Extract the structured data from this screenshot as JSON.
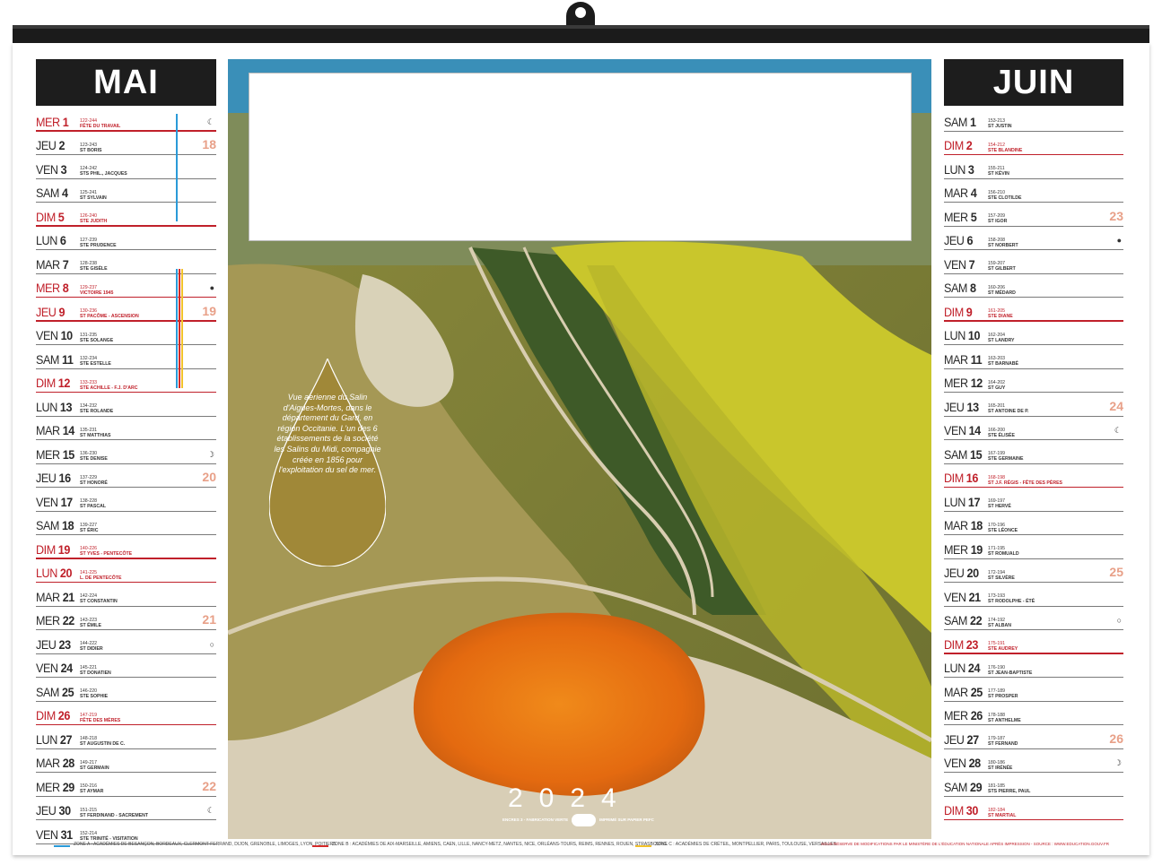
{
  "may": {
    "title": "MAI",
    "days": [
      {
        "wd": "MER",
        "n": "1",
        "num": "122-244",
        "saint": "FÊTE DU TRAVAIL",
        "red": true,
        "week": "",
        "moon": "☾"
      },
      {
        "wd": "JEU",
        "n": "2",
        "num": "123-243",
        "saint": "ST BORIS",
        "red": false,
        "week": "18",
        "moon": ""
      },
      {
        "wd": "VEN",
        "n": "3",
        "num": "124-242",
        "saint": "STS PHIL., JACQUES",
        "red": false,
        "week": "",
        "moon": ""
      },
      {
        "wd": "SAM",
        "n": "4",
        "num": "125-241",
        "saint": "ST SYLVAIN",
        "red": false,
        "week": "",
        "moon": ""
      },
      {
        "wd": "DIM",
        "n": "5",
        "num": "126-240",
        "saint": "STE JUDITH",
        "red": true,
        "week": "",
        "moon": ""
      },
      {
        "wd": "LUN",
        "n": "6",
        "num": "127-239",
        "saint": "STE PRUDENCE",
        "red": false,
        "week": "",
        "moon": ""
      },
      {
        "wd": "MAR",
        "n": "7",
        "num": "128-238",
        "saint": "STE GISÈLE",
        "red": false,
        "week": "",
        "moon": ""
      },
      {
        "wd": "MER",
        "n": "8",
        "num": "129-237",
        "saint": "VICTOIRE 1945",
        "red": true,
        "week": "",
        "moon": "●"
      },
      {
        "wd": "JEU",
        "n": "9",
        "num": "130-236",
        "saint": "ST PACÔME - ASCENSION",
        "red": true,
        "week": "19",
        "moon": ""
      },
      {
        "wd": "VEN",
        "n": "10",
        "num": "131-235",
        "saint": "STE SOLANGE",
        "red": false,
        "week": "",
        "moon": ""
      },
      {
        "wd": "SAM",
        "n": "11",
        "num": "132-234",
        "saint": "STE ESTELLE",
        "red": false,
        "week": "",
        "moon": ""
      },
      {
        "wd": "DIM",
        "n": "12",
        "num": "133-233",
        "saint": "STE ACHILLE - F.J. D'ARC",
        "red": true,
        "week": "",
        "moon": ""
      },
      {
        "wd": "LUN",
        "n": "13",
        "num": "134-232",
        "saint": "STE ROLANDE",
        "red": false,
        "week": "",
        "moon": ""
      },
      {
        "wd": "MAR",
        "n": "14",
        "num": "135-231",
        "saint": "ST MATTHIAS",
        "red": false,
        "week": "",
        "moon": ""
      },
      {
        "wd": "MER",
        "n": "15",
        "num": "136-230",
        "saint": "STE DENISE",
        "red": false,
        "week": "",
        "moon": "☽"
      },
      {
        "wd": "JEU",
        "n": "16",
        "num": "137-229",
        "saint": "ST HONORÉ",
        "red": false,
        "week": "20",
        "moon": ""
      },
      {
        "wd": "VEN",
        "n": "17",
        "num": "138-228",
        "saint": "ST PASCAL",
        "red": false,
        "week": "",
        "moon": ""
      },
      {
        "wd": "SAM",
        "n": "18",
        "num": "139-227",
        "saint": "ST ÉRIC",
        "red": false,
        "week": "",
        "moon": ""
      },
      {
        "wd": "DIM",
        "n": "19",
        "num": "140-226",
        "saint": "ST YVES - PENTECÔTE",
        "red": true,
        "week": "",
        "moon": ""
      },
      {
        "wd": "LUN",
        "n": "20",
        "num": "141-225",
        "saint": "L. DE PENTECÔTE",
        "red": true,
        "week": "",
        "moon": ""
      },
      {
        "wd": "MAR",
        "n": "21",
        "num": "142-224",
        "saint": "ST CONSTANTIN",
        "red": false,
        "week": "",
        "moon": ""
      },
      {
        "wd": "MER",
        "n": "22",
        "num": "143-223",
        "saint": "ST ÉMILE",
        "red": false,
        "week": "21",
        "moon": ""
      },
      {
        "wd": "JEU",
        "n": "23",
        "num": "144-222",
        "saint": "ST DIDIER",
        "red": false,
        "week": "",
        "moon": "○"
      },
      {
        "wd": "VEN",
        "n": "24",
        "num": "145-221",
        "saint": "ST DONATIEN",
        "red": false,
        "week": "",
        "moon": ""
      },
      {
        "wd": "SAM",
        "n": "25",
        "num": "146-220",
        "saint": "STE SOPHIE",
        "red": false,
        "week": "",
        "moon": ""
      },
      {
        "wd": "DIM",
        "n": "26",
        "num": "147-219",
        "saint": "FÊTE DES MÈRES",
        "red": true,
        "week": "",
        "moon": ""
      },
      {
        "wd": "LUN",
        "n": "27",
        "num": "148-218",
        "saint": "ST AUGUSTIN DE C.",
        "red": false,
        "week": "",
        "moon": ""
      },
      {
        "wd": "MAR",
        "n": "28",
        "num": "149-217",
        "saint": "ST GERMAIN",
        "red": false,
        "week": "",
        "moon": ""
      },
      {
        "wd": "MER",
        "n": "29",
        "num": "150-216",
        "saint": "ST AYMAR",
        "red": false,
        "week": "22",
        "moon": ""
      },
      {
        "wd": "JEU",
        "n": "30",
        "num": "151-215",
        "saint": "ST FERDINAND - SACREMENT",
        "red": false,
        "week": "",
        "moon": "☾"
      },
      {
        "wd": "VEN",
        "n": "31",
        "num": "152-214",
        "saint": "STE TRINITÉ - VISITATION",
        "red": false,
        "week": "",
        "moon": ""
      }
    ]
  },
  "june": {
    "title": "JUIN",
    "days": [
      {
        "wd": "SAM",
        "n": "1",
        "num": "153-213",
        "saint": "ST JUSTIN",
        "red": false,
        "week": "",
        "moon": ""
      },
      {
        "wd": "DIM",
        "n": "2",
        "num": "154-212",
        "saint": "STE BLANDINE",
        "red": true,
        "week": "",
        "moon": ""
      },
      {
        "wd": "LUN",
        "n": "3",
        "num": "155-211",
        "saint": "ST KÉVIN",
        "red": false,
        "week": "",
        "moon": ""
      },
      {
        "wd": "MAR",
        "n": "4",
        "num": "156-210",
        "saint": "STE CLOTILDE",
        "red": false,
        "week": "",
        "moon": ""
      },
      {
        "wd": "MER",
        "n": "5",
        "num": "157-209",
        "saint": "ST IGOR",
        "red": false,
        "week": "23",
        "moon": ""
      },
      {
        "wd": "JEU",
        "n": "6",
        "num": "158-208",
        "saint": "ST NORBERT",
        "red": false,
        "week": "",
        "moon": "●"
      },
      {
        "wd": "VEN",
        "n": "7",
        "num": "159-207",
        "saint": "ST GILBERT",
        "red": false,
        "week": "",
        "moon": ""
      },
      {
        "wd": "SAM",
        "n": "8",
        "num": "160-206",
        "saint": "ST MÉDARD",
        "red": false,
        "week": "",
        "moon": ""
      },
      {
        "wd": "DIM",
        "n": "9",
        "num": "161-205",
        "saint": "STE DIANE",
        "red": true,
        "week": "",
        "moon": ""
      },
      {
        "wd": "LUN",
        "n": "10",
        "num": "162-204",
        "saint": "ST LANDRY",
        "red": false,
        "week": "",
        "moon": ""
      },
      {
        "wd": "MAR",
        "n": "11",
        "num": "163-203",
        "saint": "ST BARNABÉ",
        "red": false,
        "week": "",
        "moon": ""
      },
      {
        "wd": "MER",
        "n": "12",
        "num": "164-202",
        "saint": "ST GUY",
        "red": false,
        "week": "",
        "moon": ""
      },
      {
        "wd": "JEU",
        "n": "13",
        "num": "165-201",
        "saint": "ST ANTOINE DE P.",
        "red": false,
        "week": "24",
        "moon": ""
      },
      {
        "wd": "VEN",
        "n": "14",
        "num": "166-200",
        "saint": "STE ÉLISÉE",
        "red": false,
        "week": "",
        "moon": "☾"
      },
      {
        "wd": "SAM",
        "n": "15",
        "num": "167-199",
        "saint": "STE GERMAINE",
        "red": false,
        "week": "",
        "moon": ""
      },
      {
        "wd": "DIM",
        "n": "16",
        "num": "168-198",
        "saint": "ST J.F. RÉGIS - FÊTE DES PÈRES",
        "red": true,
        "week": "",
        "moon": ""
      },
      {
        "wd": "LUN",
        "n": "17",
        "num": "169-197",
        "saint": "ST HERVÉ",
        "red": false,
        "week": "",
        "moon": ""
      },
      {
        "wd": "MAR",
        "n": "18",
        "num": "170-196",
        "saint": "STE LÉONCE",
        "red": false,
        "week": "",
        "moon": ""
      },
      {
        "wd": "MER",
        "n": "19",
        "num": "171-195",
        "saint": "ST ROMUALD",
        "red": false,
        "week": "",
        "moon": ""
      },
      {
        "wd": "JEU",
        "n": "20",
        "num": "172-194",
        "saint": "ST SILVÈRE",
        "red": false,
        "week": "25",
        "moon": ""
      },
      {
        "wd": "VEN",
        "n": "21",
        "num": "173-193",
        "saint": "ST RODOLPHE - ÉTÉ",
        "red": false,
        "week": "",
        "moon": ""
      },
      {
        "wd": "SAM",
        "n": "22",
        "num": "174-192",
        "saint": "ST ALBAN",
        "red": false,
        "week": "",
        "moon": "○"
      },
      {
        "wd": "DIM",
        "n": "23",
        "num": "175-191",
        "saint": "STE AUDREY",
        "red": true,
        "week": "",
        "moon": ""
      },
      {
        "wd": "LUN",
        "n": "24",
        "num": "176-190",
        "saint": "ST JEAN-BAPTISTE",
        "red": false,
        "week": "",
        "moon": ""
      },
      {
        "wd": "MAR",
        "n": "25",
        "num": "177-189",
        "saint": "ST PROSPER",
        "red": false,
        "week": "",
        "moon": ""
      },
      {
        "wd": "MER",
        "n": "26",
        "num": "178-188",
        "saint": "ST ANTHELME",
        "red": false,
        "week": "",
        "moon": ""
      },
      {
        "wd": "JEU",
        "n": "27",
        "num": "179-187",
        "saint": "ST FERNAND",
        "red": false,
        "week": "26",
        "moon": ""
      },
      {
        "wd": "VEN",
        "n": "28",
        "num": "180-186",
        "saint": "ST IRÉNÉE",
        "red": false,
        "week": "",
        "moon": "☽"
      },
      {
        "wd": "SAM",
        "n": "29",
        "num": "181-185",
        "saint": "STS PIERRE, PAUL",
        "red": false,
        "week": "",
        "moon": ""
      },
      {
        "wd": "DIM",
        "n": "30",
        "num": "182-184",
        "saint": "ST MARTIAL",
        "red": true,
        "week": "",
        "moon": ""
      }
    ]
  },
  "photo": {
    "caption": "Vue aerienne du Salin d'Aigues-Mortes, dans le département du Gard, en région Occitanie. L'un des 6 établissements de la société les Salins du Midi, compagnie créée en 1856 pour l'exploitation du sel de mer.",
    "year": "2024",
    "footnote_left": "ENCRES 3 - FABRICATION VERTE",
    "footnote_right": "IMPRIMÉ SUR PAPIER PEFC"
  },
  "zones": {
    "a": "ZONE A : ACADÉMIES DE BESANÇON, BORDEAUX, CLERMONT-FERRAND, DIJON, GRENOBLE, LIMOGES, LYON, POITIERS.",
    "b": "ZONE B : ACADÉMIES DE AIX-MARSEILLE, AMIENS, CAEN, LILLE, NANCY-METZ, NANTES, NICE, ORLÉANS-TOURS, REIMS, RENNES, ROUEN, STRASBOURG.",
    "c": "ZONE C : ACADÉMIES DE CRÉTEIL, MONTPELLIER, PARIS, TOULOUSE, VERSAILLES.",
    "note": "SOUS RÉSERVE DE MODIFICATIONS PAR LE MINISTÈRE DE L'ÉDUCATION NATIONALE APRÈS IMPRESSION - SOURCE : WWW.EDUCATION.GOUV.FR"
  },
  "colors": {
    "red": "#c0202a",
    "zone_a": "#2a9ad8",
    "zone_b": "#d42a2a",
    "zone_c": "#f2c22a",
    "week_number": "#e8a088"
  }
}
